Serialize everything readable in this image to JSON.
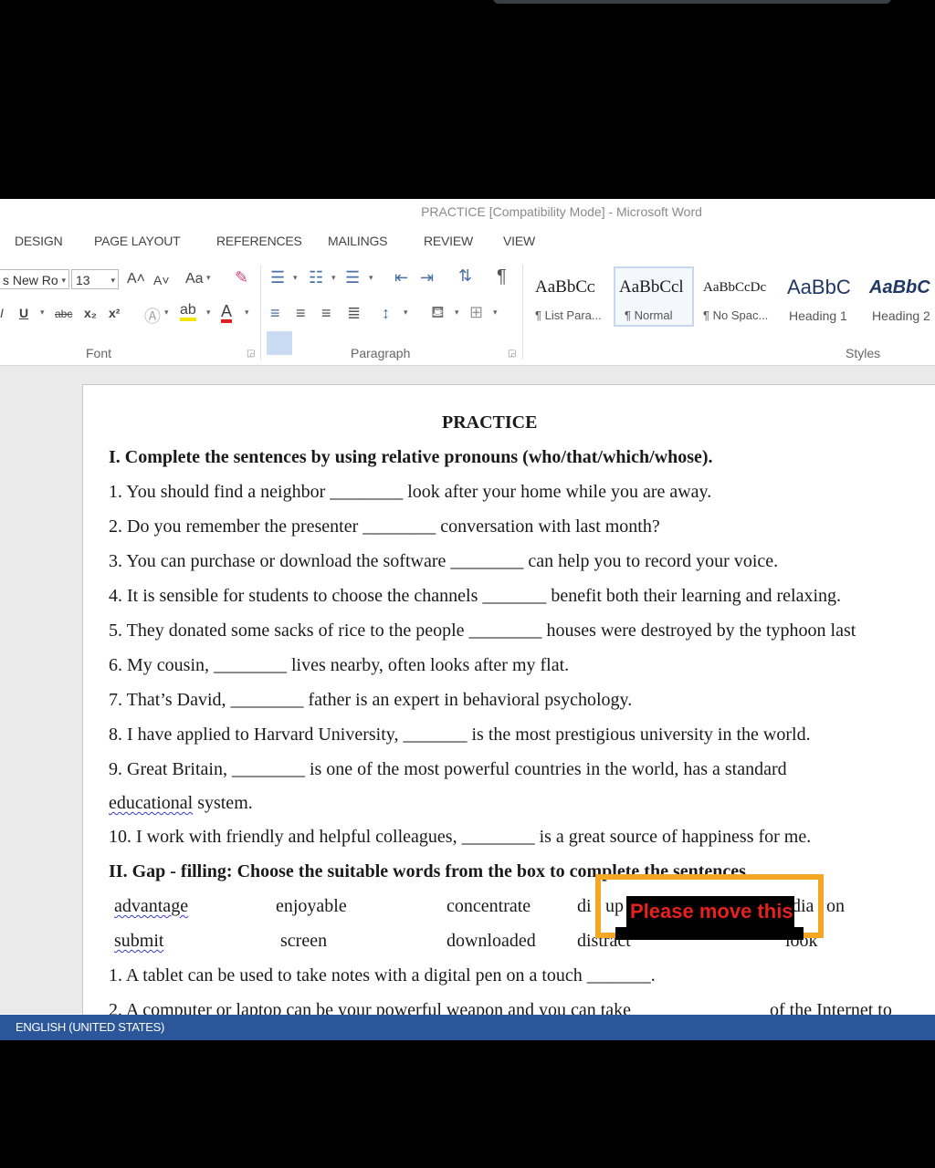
{
  "window_title": "PRACTICE [Compatibility Mode] - Microsoft Word",
  "tabs": [
    "DESIGN",
    "PAGE LAYOUT",
    "REFERENCES",
    "MAILINGS",
    "REVIEW",
    "VIEW"
  ],
  "ribbon": {
    "font_name": "s New Ro",
    "font_size": "13",
    "grow_font": "A˄",
    "shrink_font": "A˅",
    "change_case": "Aa",
    "underline": "U",
    "strikethrough": "abc",
    "subscript": "x₂",
    "superscript": "x²",
    "font_color_letter": "A",
    "pilcrow": "¶",
    "group_font": "Font",
    "group_paragraph": "Paragraph",
    "group_styles": "Styles",
    "styles": [
      {
        "sample": "AaBbCᴄ",
        "name": "¶ List Para..."
      },
      {
        "sample": "AaBbCcl",
        "name": "¶ Normal"
      },
      {
        "sample": "AaBbCcDc",
        "name": "¶ No Spac..."
      },
      {
        "sample": "AaBbC",
        "name": "Heading 1"
      },
      {
        "sample": "AaBbC",
        "name": "Heading 2"
      }
    ]
  },
  "document": {
    "title": "PRACTICE",
    "section1_heading": "I. Complete the sentences by using relative pronouns (who/that/which/whose).",
    "section1_lines": [
      "1. You should find a neighbor ________ look after your home while you are away.",
      "2. Do you remember the presenter ________ conversation with last month?",
      "3. You can purchase or download the software ________ can help you to record your voice.",
      "4. It is sensible for students to choose the channels _______ benefit both their learning and relaxing.",
      "5. They donated some sacks of rice to the people ________ houses were destroyed by the typhoon last",
      "6. My cousin, ________ lives nearby, often looks after my flat.",
      "7. That’s David, ________ father is an expert in behavioral psychology.",
      "8. I have applied to Harvard University, _______ is the most prestigious university in the world.",
      "9. Great Britain, ________ is one of the most powerful countries in the world, has a standard"
    ],
    "line9_cont_word": "educational",
    "line9_cont_rest": " system.",
    "line10": "10. I work with friendly and helpful colleagues, ________ is a great source of happiness for me.",
    "section2_heading": "II. Gap - filling: Choose the suitable words from the box to complete the sentences",
    "word_box_row1": [
      "advantage",
      "enjoyable",
      "concentrate",
      "di",
      "up",
      "dia",
      "on"
    ],
    "word_box_row2": [
      "submit",
      "screen",
      "downloaded",
      "distract",
      "look"
    ],
    "section2_line1": "1. A tablet can be used to take notes with a digital pen on a touch _______.",
    "section2_line2": "2. A computer or laptop can be your powerful weapon and you can take",
    "section2_line2_end": "of the Internet to"
  },
  "status_bar": "ENGLISH (UNITED STATES)",
  "overlay_text": "Please move this",
  "colors": {
    "status_bar": "#2b579a",
    "overlay_border": "#f5a623",
    "overlay_text": "#e8201e"
  }
}
